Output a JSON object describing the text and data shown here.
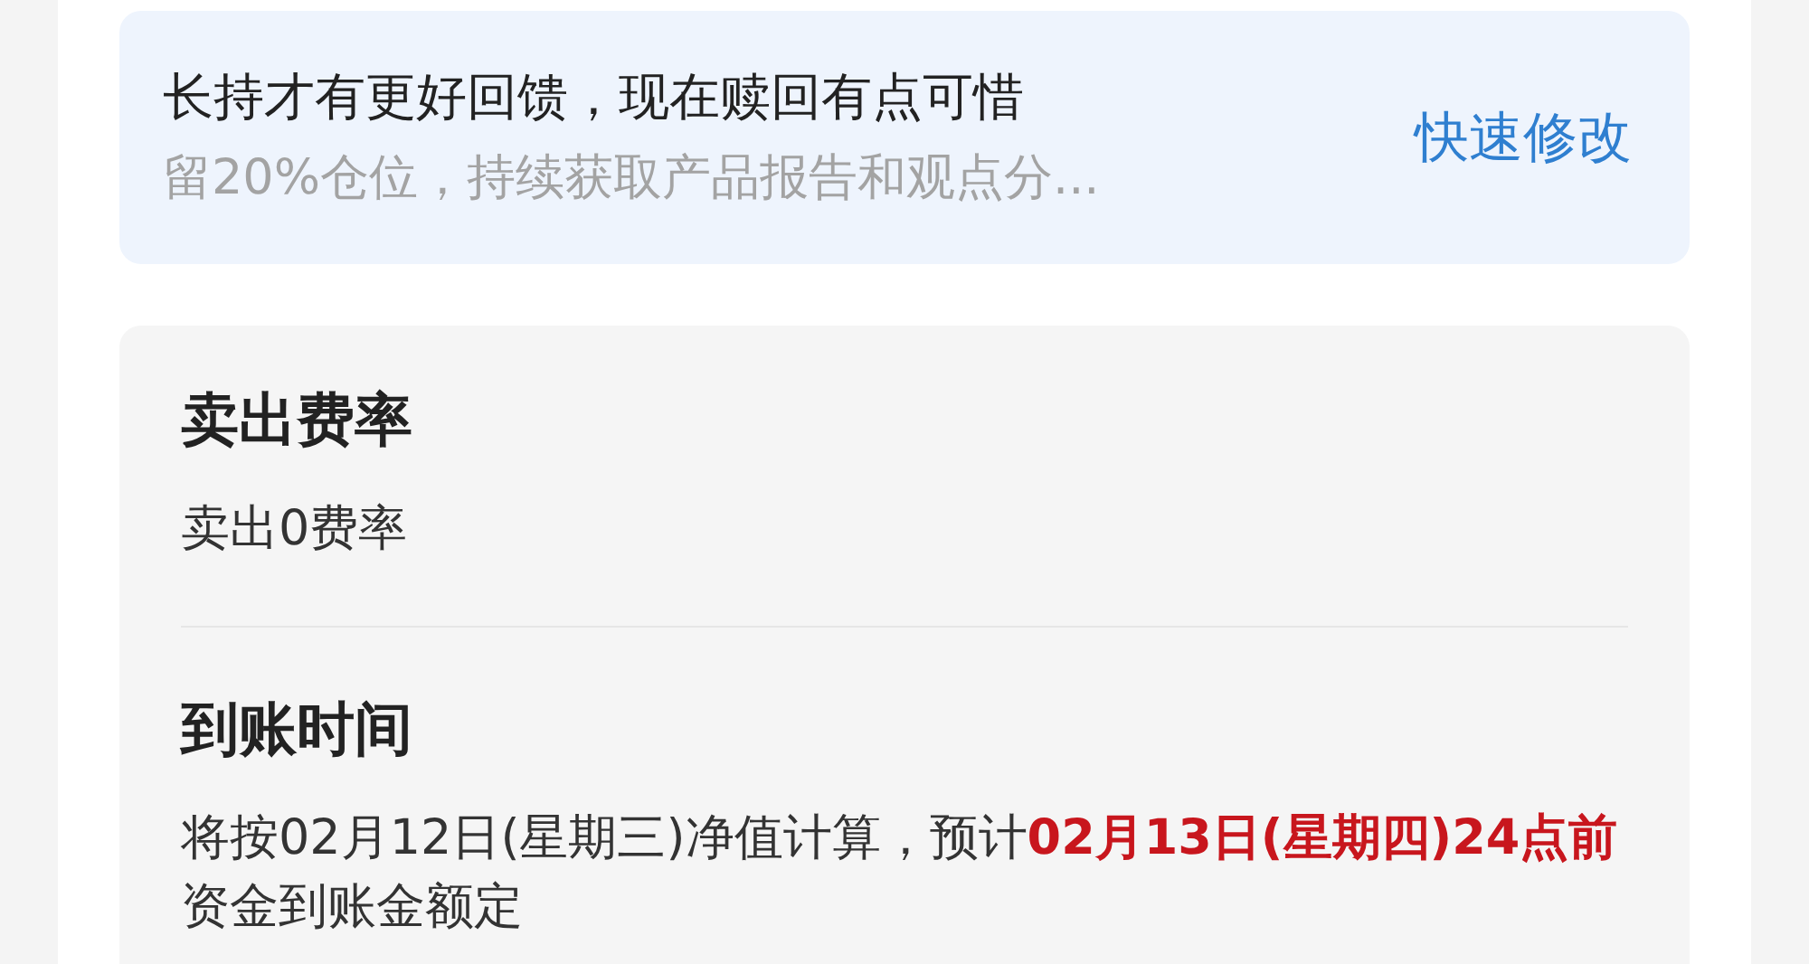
{
  "notice": {
    "title": "长持才有更好回馈，现在赎回有点可惜",
    "subtitle": "留20%仓位，持续获取产品报告和观点分...",
    "action": "快速修改"
  },
  "sections": [
    {
      "heading": "卖出费率",
      "text": "卖出0费率"
    },
    {
      "heading": "到账时间",
      "text": "将按02月12日(星期三)净值计算，预计**02月13日(星期四)24点前**资金到账金额定"
    }
  ]
}
